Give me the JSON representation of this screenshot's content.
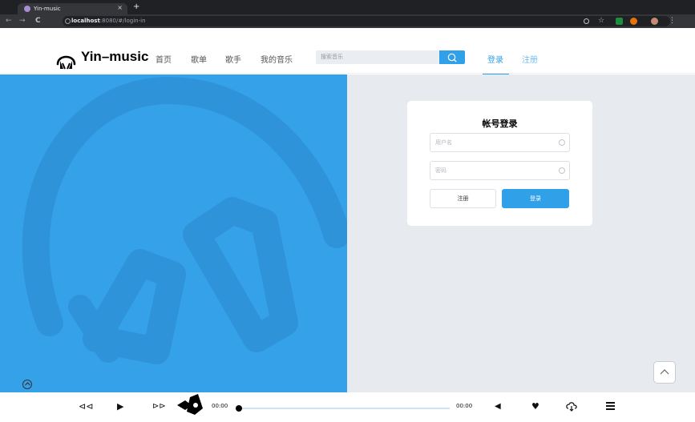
{
  "browser": {
    "tab_title": "Yin-music",
    "tab_close": "×",
    "new_tab": "+",
    "url_host": "localhost",
    "url_rest": ":8080/#/login-in",
    "back": "←",
    "forward": "→",
    "reload": "C"
  },
  "header": {
    "logo_text": "Yin–music",
    "nav": [
      "首页",
      "歌单",
      "歌手",
      "我的音乐"
    ],
    "search_placeholder": "搜索音乐",
    "login_label": "登录",
    "register_label": "注册"
  },
  "login": {
    "title": "帐号登录",
    "username_placeholder": "用户名",
    "password_placeholder": "密码",
    "register_button": "注册",
    "login_button": "登录"
  },
  "player": {
    "current_time": "00:00",
    "total_time": "00:00",
    "progress": 0
  },
  "colors": {
    "accent": "#30a0e8",
    "hero_bg": "#34a1e9",
    "page_bg": "#e7eaee"
  }
}
